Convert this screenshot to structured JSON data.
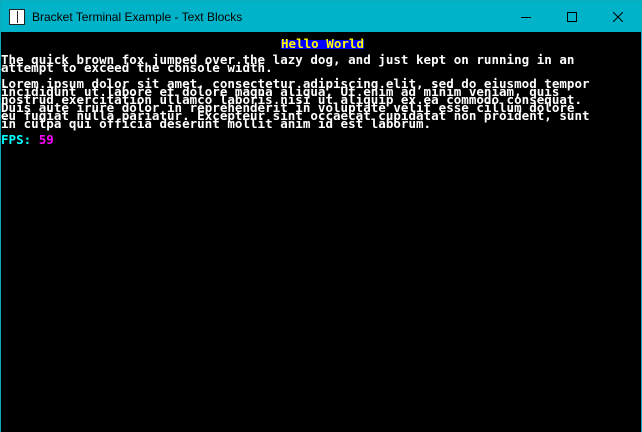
{
  "window": {
    "title": "Bracket Terminal Example - Text Blocks",
    "controls": {
      "minimize": "minimize",
      "maximize": "maximize",
      "close": "close"
    }
  },
  "console": {
    "hello": "Hello World",
    "line1": [
      "The quick brown fox jumped over the lazy dog, and just kept on running in an",
      "attempt to exceed the console width."
    ],
    "paragraph": [
      "Lorem ipsum dolor sit amet, consectetur adipiscing elit, sed do eiusmod tempor",
      "incididunt ut labore et dolore magna aliqua. Ut enim ad minim veniam, quis",
      "nostrud exercitation ullamco laboris nisi ut aliquip ex ea commodo consequat.",
      "Duis aute irure dolor in reprehenderit in voluptate velit esse cillum dolore",
      "eu fugiat nulla pariatur. Excepteur sint occaecat cupidatat non proident, sunt",
      "in culpa qui officia deserunt mollit anim id est laborum."
    ],
    "fps_label": "FPS: ",
    "fps_value": "59"
  },
  "colors": {
    "titlebar": "#00b3c8",
    "console_bg": "#000000",
    "text": "#ffffff",
    "hello_bg": "#0000ff",
    "hello_fg": "#ffff00",
    "fps_label": "#00ffff",
    "fps_value": "#ff00ff"
  }
}
